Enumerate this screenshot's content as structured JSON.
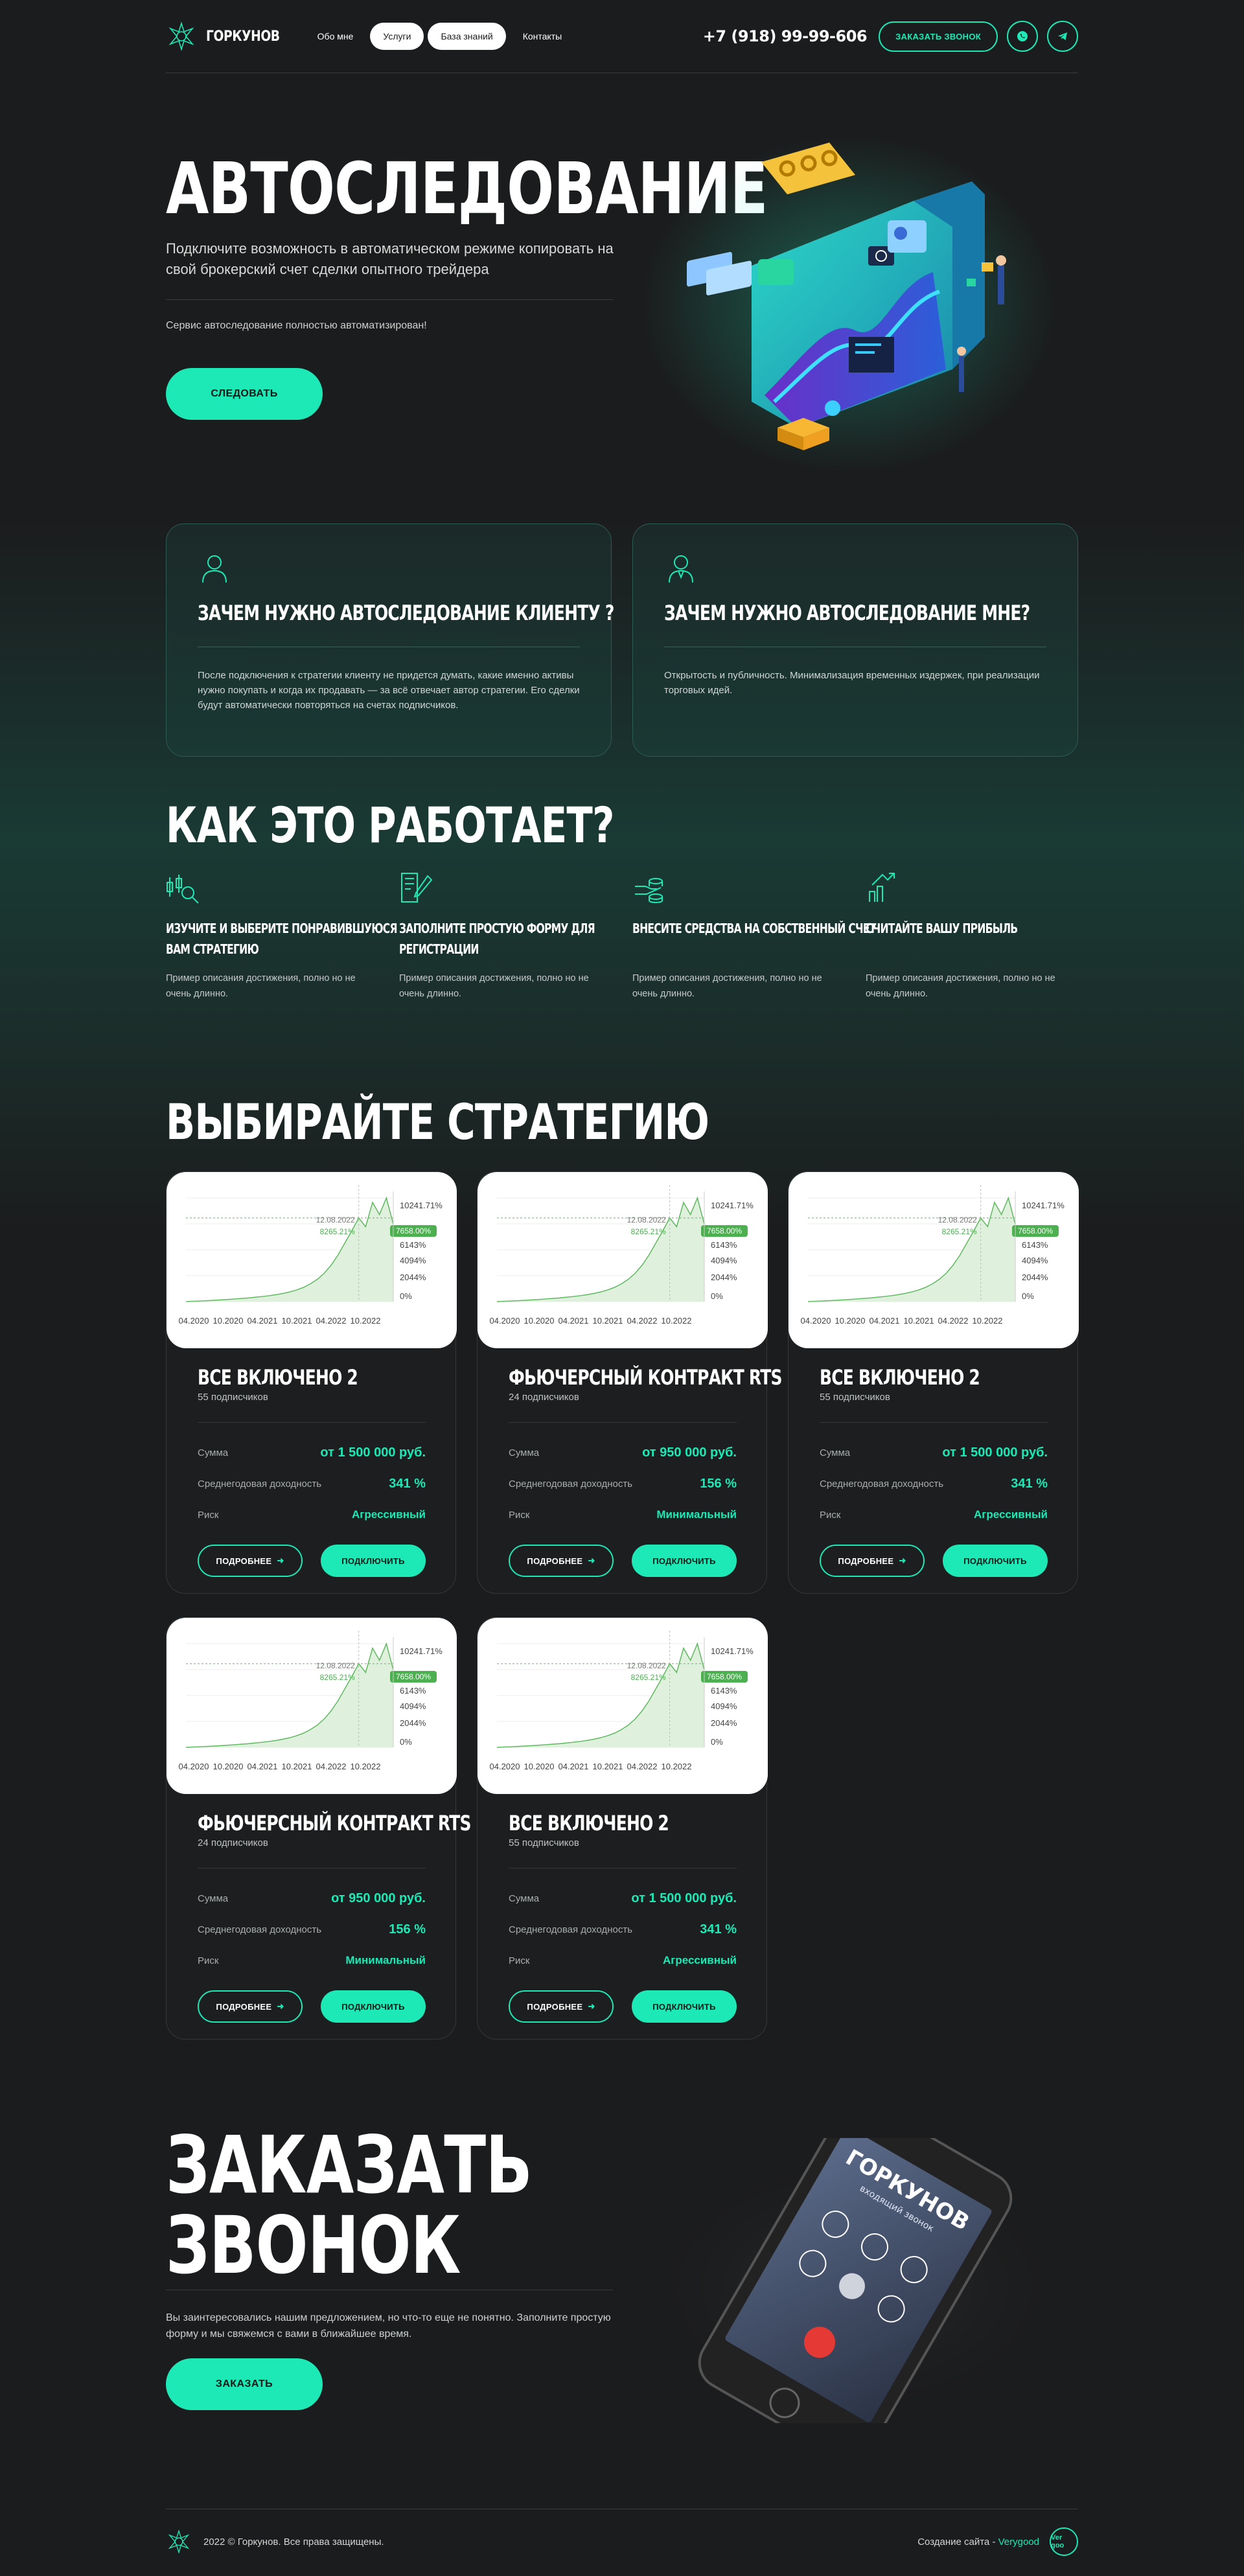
{
  "header": {
    "logo_text": "ГОРКУНОВ",
    "nav": [
      {
        "label": "Обо мне"
      },
      {
        "label": "Услуги"
      },
      {
        "label": "База знаний"
      },
      {
        "label": "Контакты"
      }
    ],
    "phone": "+7 (918) 99-99-606",
    "call_button": "ЗАКАЗАТЬ ЗВОНОК",
    "social": [
      "whatsapp-icon",
      "telegram-icon"
    ]
  },
  "hero": {
    "title": "АВТОСЛЕДОВАНИЕ",
    "subtitle": "Подключите возможность в автоматическом режиме копировать на свой брокерский счет сделки опытного трейдера",
    "note": "Сервис автоследование полностью автоматизирован!",
    "button": "СЛЕДОВАТЬ"
  },
  "why": [
    {
      "title": "ЗАЧЕМ НУЖНО АВТОСЛЕДОВАНИЕ КЛИЕНТУ ?",
      "text": "После подключения к стратегии клиенту не придется думать, какие именно активы нужно покупать и когда их продавать — за всё отвечает автор стратегии. Его сделки будут автоматически повторяться на счетах подписчиков."
    },
    {
      "title": "ЗАЧЕМ НУЖНО АВТОСЛЕДОВАНИЕ МНЕ?",
      "text": "Открытость и публичность. Минимализация временных издержек, при реализации торговых идей."
    }
  ],
  "how": {
    "title": "КАК ЭТО РАБОТАЕТ?",
    "steps": [
      {
        "title_1": "ИЗУЧИТЕ И ВЫБЕРИТЕ ПОНРАВИВШУЮСЯ",
        "title_2": "ВАМ СТРАТЕГИЮ",
        "text": "Пример описания достижения, полно но не очень длинно.",
        "icon": "chart-search-icon"
      },
      {
        "title_1": "ЗАПОЛНИТЕ ПРОСТУЮ ФОРМУ ДЛЯ",
        "title_2": "РЕГИСТРАЦИИ",
        "text": "Пример описания достижения, полно но не очень длинно.",
        "icon": "form-pen-icon"
      },
      {
        "title_1": "ВНЕСИТЕ СРЕДСТВА НА СОБСТВЕННЫЙ СЧЕТ",
        "title_2": "",
        "text": "Пример описания достижения, полно но не очень длинно.",
        "icon": "coins-hand-icon"
      },
      {
        "title_1": "СЧИТАЙТЕ ВАШУ ПРИБЫЛЬ",
        "title_2": "",
        "text": "Пример описания достижения, полно но не очень длинно.",
        "icon": "growth-arrow-icon"
      }
    ]
  },
  "strategies": {
    "title": "ВЫБИРАЙТЕ СТРАТЕГИЮ",
    "labels": {
      "sum": "Сумма",
      "yield": "Среднегодовая доходность",
      "risk": "Риск",
      "more": "ПОДРОБНЕЕ",
      "connect": "ПОДКЛЮЧИТЬ"
    },
    "items": [
      {
        "title": "ВСЕ ВКЛЮЧЕНО 2",
        "subs": "55 подписчиков",
        "sum": "от 1 500 000 руб.",
        "yield": "341 %",
        "risk": "Агрессивный"
      },
      {
        "title": "ФЬЮЧЕРСНЫЙ КОНТРАКТ RTS",
        "subs": "24 подписчиков",
        "sum": "от 950 000 руб.",
        "yield": "156 %",
        "risk": "Минимальный"
      },
      {
        "title": "ВСЕ ВКЛЮЧЕНО 2",
        "subs": "55 подписчиков",
        "sum": "от 1 500 000 руб.",
        "yield": "341 %",
        "risk": "Агрессивный"
      },
      {
        "title": "ФЬЮЧЕРСНЫЙ КОНТРАКТ RTS",
        "subs": "24 подписчиков",
        "sum": "от 950 000 руб.",
        "yield": "156 %",
        "risk": "Минимальный"
      },
      {
        "title": "ВСЕ ВКЛЮЧЕНО 2",
        "subs": "55 подписчиков",
        "sum": "от 1 500 000 руб.",
        "yield": "341 %",
        "risk": "Агрессивный"
      }
    ]
  },
  "chart_data": {
    "type": "area",
    "x_ticks": [
      "04.2020",
      "10.2020",
      "04.2021",
      "10.2021",
      "04.2022",
      "10.2022"
    ],
    "y_ticks": [
      "10241.71%",
      "7658.00%",
      "6143%",
      "4094%",
      "2044%",
      "0%"
    ],
    "tooltip_date": "12.08.2022",
    "tooltip_value": "8265.21%",
    "current_label": "7658.00%",
    "series": [
      {
        "values": [
          0,
          30,
          60,
          90,
          130,
          170,
          210,
          260,
          310,
          360,
          430,
          500,
          580,
          680,
          800,
          950,
          1150,
          1400,
          1750,
          2200,
          2800,
          3600,
          4600,
          5800,
          7000,
          8265,
          7400,
          9800,
          8600,
          10241,
          7658
        ]
      }
    ],
    "colors": {
      "line": "#5fb85f",
      "fill": "#dff0dc",
      "label": "#4caf50"
    }
  },
  "call": {
    "title_1": "ЗАКАЗАТЬ",
    "title_2": "ЗВОНОК",
    "text": "Вы заинтересовались нашим предложением, но что-то еще не понятно. Заполните простую форму и мы свяжемся с вами в ближайшее время.",
    "button": "ЗАКАЗАТЬ",
    "phone_screen_title": "ГОРКУНОВ",
    "phone_screen_sub": "входящий звонок"
  },
  "footer": {
    "copyright": "2022 © Горкунов. Все права защищены.",
    "made_by": "Создание сайта -",
    "studio": "Verygood",
    "badge": "Ver goo"
  },
  "colors": {
    "accent": "#1de9b6",
    "bg": "#1b1c1d"
  }
}
